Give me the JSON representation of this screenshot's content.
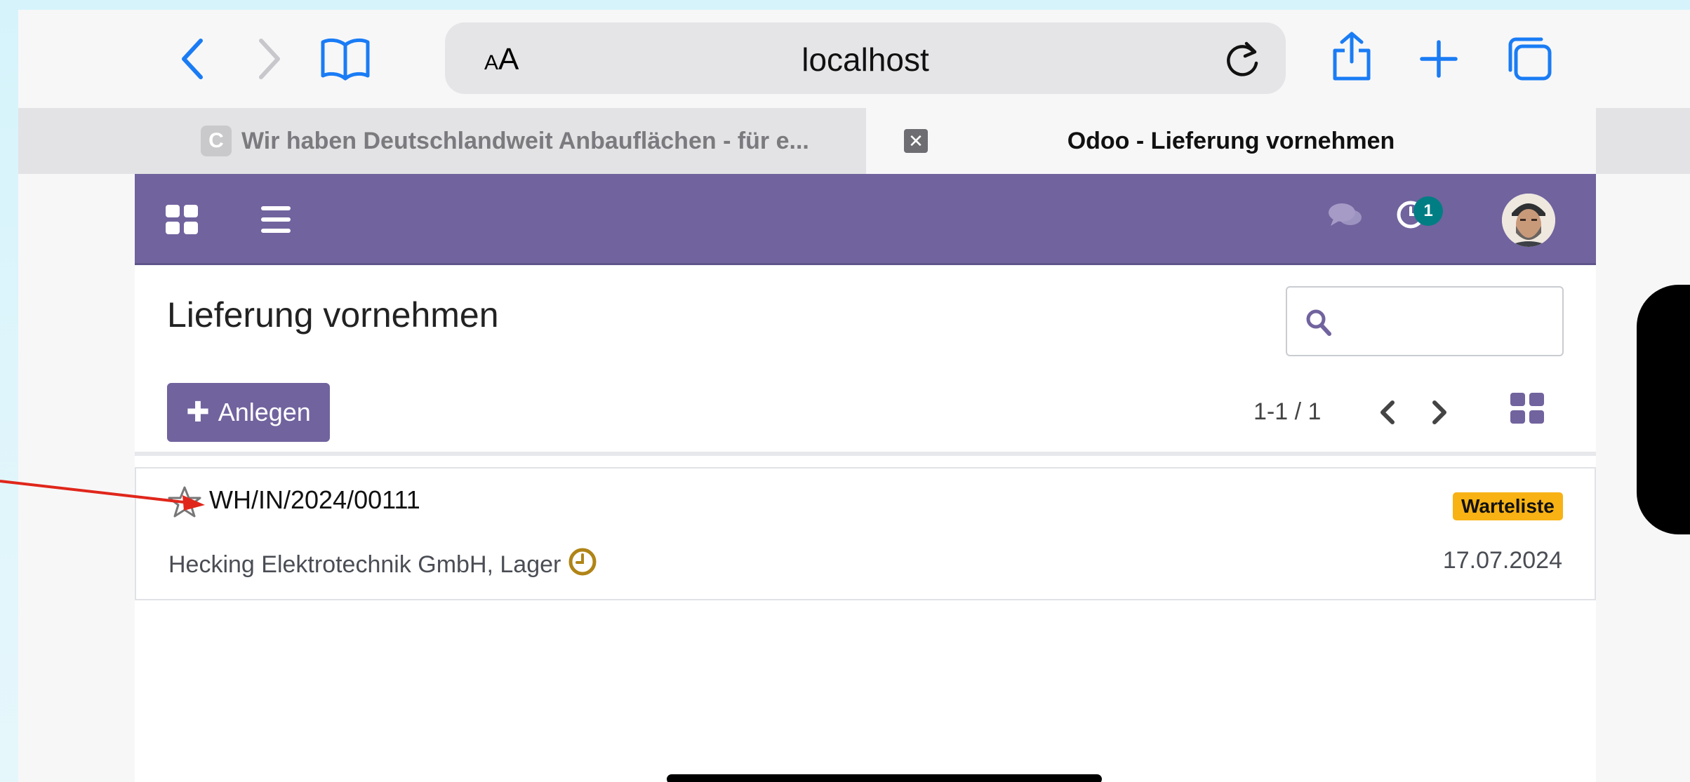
{
  "browser": {
    "url": "localhost",
    "text_size_label_small": "A",
    "text_size_label_large": "A",
    "tabs": [
      {
        "favicon_letter": "C",
        "title": "Wir haben Deutschlandweit Anbauflächen - für e..."
      },
      {
        "title": "Odoo - Lieferung vornehmen"
      }
    ]
  },
  "navbar": {
    "activity_count": "1",
    "accent_color": "#71639e"
  },
  "control_panel": {
    "title": "Lieferung vornehmen",
    "search_placeholder": "",
    "create_button_label": "Anlegen",
    "pager": "1-1 / 1"
  },
  "records": [
    {
      "reference": "WH/IN/2024/00111",
      "state": "Warteliste",
      "partner": "Hecking Elektrotechnik GmbH, Lager",
      "date": "17.07.2024"
    }
  ]
}
